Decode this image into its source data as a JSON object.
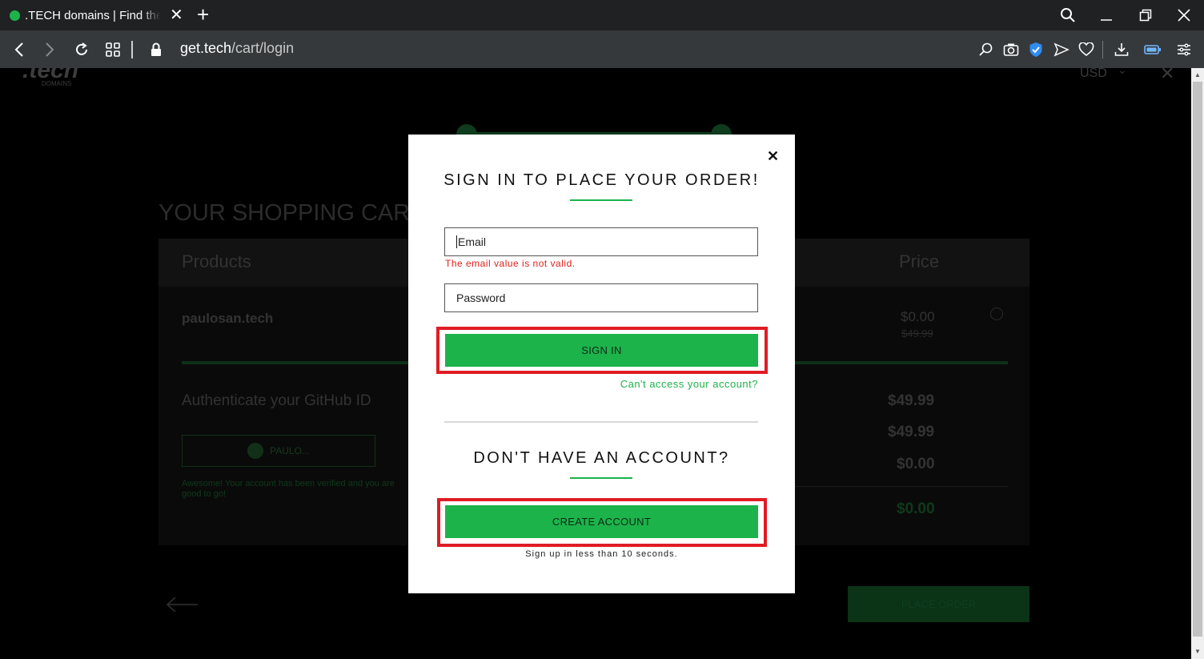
{
  "browser": {
    "tab_title": ".TECH domains | Find the perfect domain",
    "url_host": "get.tech",
    "url_path": "/cart/login"
  },
  "page": {
    "logo_text": ".tech",
    "logo_sub": "DOMAINS",
    "currency": "USD",
    "cart_heading": "YOUR SHOPPING CART",
    "col_products": "Products",
    "col_price": "Price",
    "item_name": "paulosan.tech",
    "item_price": "$0.00",
    "item_old_price": "$49.99",
    "github_heading": "Authenticate your GitHub ID",
    "github_button": "PAULO...",
    "github_note": "Awesome! Your account has been verified and you are good to go!",
    "summary_values": [
      "$49.99",
      "$49.99",
      "$0.00"
    ],
    "total_value": "$0.00",
    "place_order": "PLACE ORDER"
  },
  "modal": {
    "title": "SIGN IN TO PLACE YOUR ORDER!",
    "email_placeholder": "Email",
    "email_error": "The email value is not valid.",
    "password_placeholder": "Password",
    "sign_in_label": "SIGN IN",
    "forgot_link": "Can't access your account?",
    "no_account_title": "DON'T HAVE AN ACCOUNT?",
    "create_account_label": "CREATE ACCOUNT",
    "signup_note": "Sign up in less than 10 seconds."
  },
  "colors": {
    "accent": "#1db34b",
    "error": "#e0201b",
    "highlight": "#e01c24"
  }
}
